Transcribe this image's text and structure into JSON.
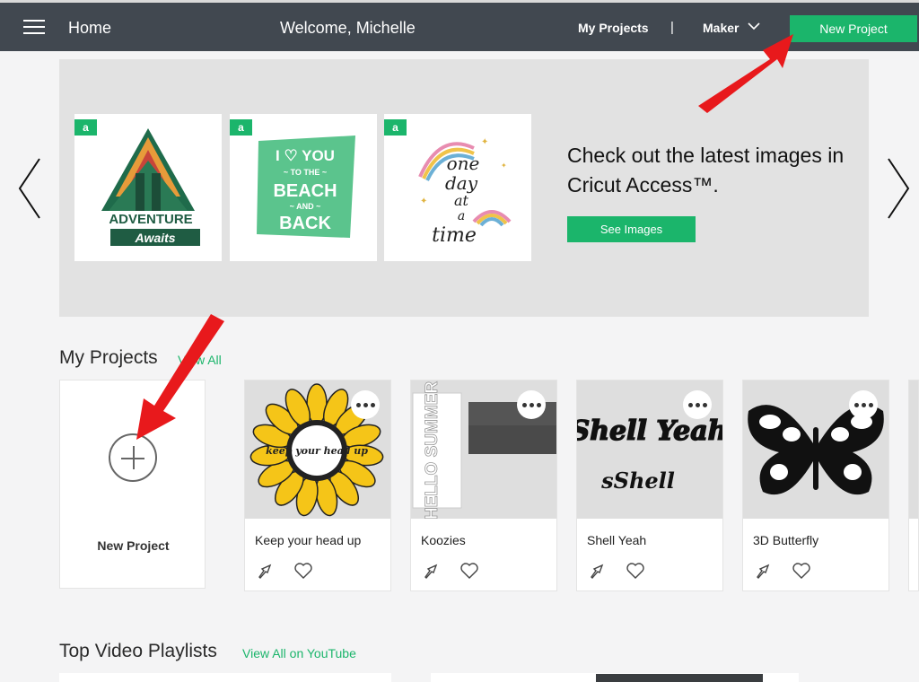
{
  "nav": {
    "home": "Home",
    "welcome": "Welcome, Michelle",
    "my_projects": "My Projects",
    "separator": "|",
    "machine": "Maker",
    "new_project": "New Project"
  },
  "banner": {
    "badge": "a",
    "tiles": [
      {
        "label_top": "ADVENTURE",
        "label_bottom": "Awaits"
      },
      {
        "line1": "I ♡ YOU",
        "line2": "~ TO THE ~",
        "line3": "BEACH",
        "line4": "~ AND ~",
        "line5": "BACK"
      },
      {
        "line1": "one",
        "line2": "day",
        "line3": "at",
        "line4": "a",
        "line5": "time"
      }
    ],
    "headline": "Check out the latest images in Cricut Access™.",
    "button": "See Images"
  },
  "my_projects": {
    "title": "My Projects",
    "view_all": "View All",
    "new_project_label": "New Project",
    "projects": [
      {
        "name": "Keep your head up",
        "art": "keep your head up"
      },
      {
        "name": "Koozies",
        "art": "HELLO SUMMER"
      },
      {
        "name": "Shell Yeah",
        "art_line1": "Shell Yeah",
        "art_line2": "sShell"
      },
      {
        "name": "3D Butterfly"
      }
    ]
  },
  "playlists": {
    "title": "Top Video Playlists",
    "view_all": "View All on YouTube"
  },
  "colors": {
    "nav_bg": "#414850",
    "accent": "#1bb56b",
    "annotation_arrow": "#e8191c"
  }
}
